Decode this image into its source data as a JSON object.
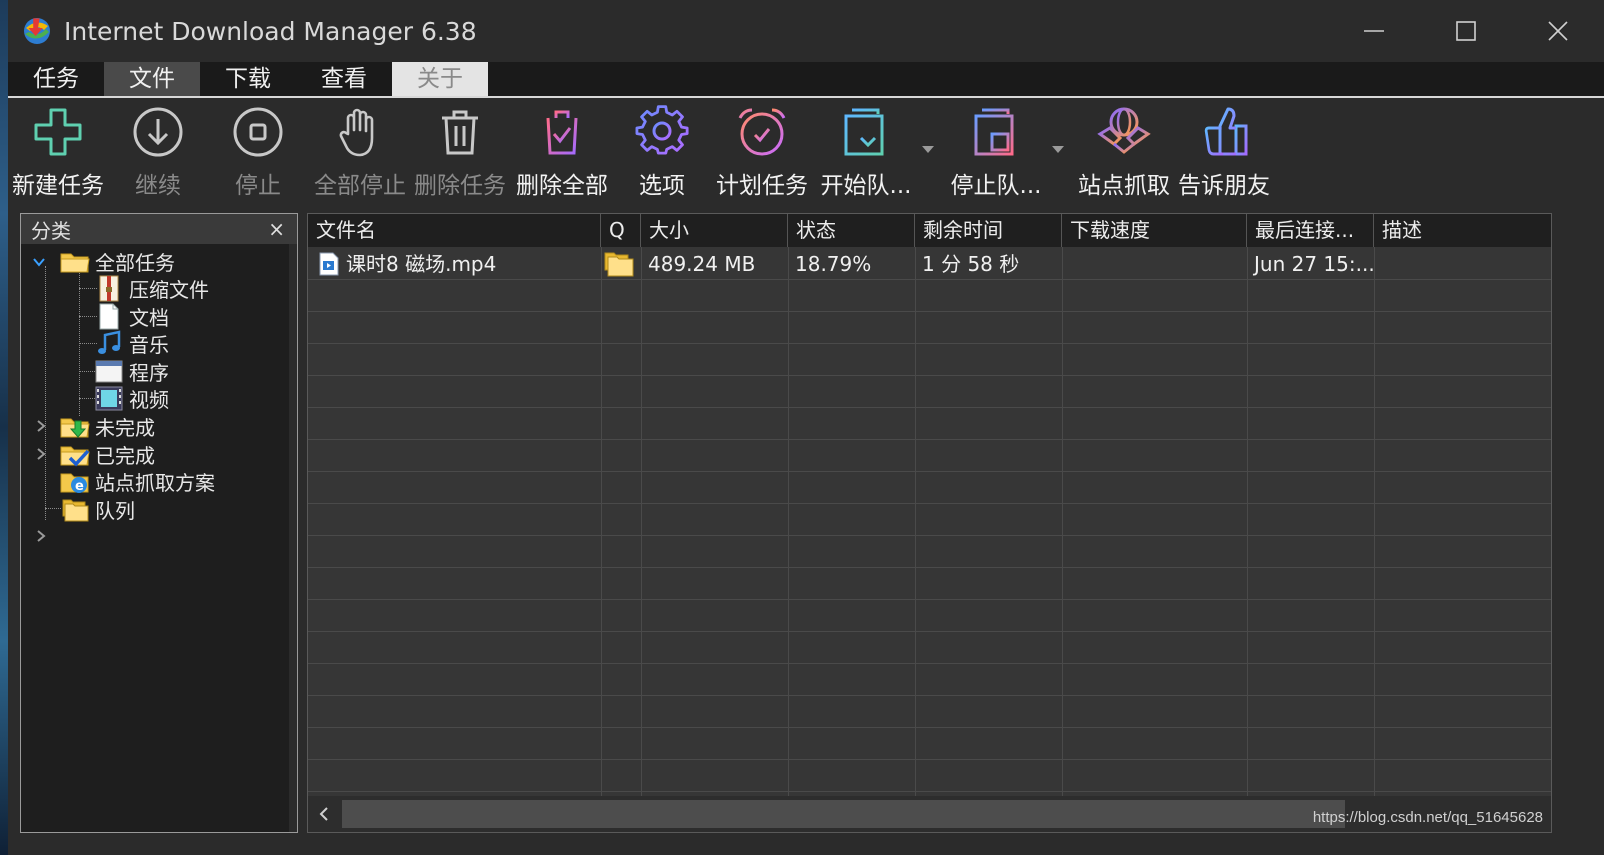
{
  "window": {
    "title": "Internet Download Manager 6.38"
  },
  "menu": [
    {
      "label": "任务",
      "state": "normal"
    },
    {
      "label": "文件",
      "state": "active"
    },
    {
      "label": "下载",
      "state": "normal"
    },
    {
      "label": "查看",
      "state": "normal"
    },
    {
      "label": "关于",
      "state": "disabled"
    }
  ],
  "toolbar": [
    {
      "label": "新建任务",
      "icon": "plus-icon",
      "enabled": true
    },
    {
      "label": "继续",
      "icon": "resume-download-icon",
      "enabled": false
    },
    {
      "label": "停止",
      "icon": "stop-icon",
      "enabled": false
    },
    {
      "label": "全部停止",
      "icon": "hand-stop-icon",
      "enabled": false
    },
    {
      "label": "删除任务",
      "icon": "trash-icon",
      "enabled": false
    },
    {
      "label": "删除全部",
      "icon": "delete-all-icon",
      "enabled": true
    },
    {
      "label": "选项",
      "icon": "gear-icon",
      "enabled": true
    },
    {
      "label": "计划任务",
      "icon": "alarm-clock-icon",
      "enabled": true
    },
    {
      "label": "开始队...",
      "icon": "start-queue-icon",
      "enabled": true
    },
    {
      "label": "停止队...",
      "icon": "stop-queue-icon",
      "enabled": true
    },
    {
      "label": "站点抓取",
      "icon": "site-grabber-icon",
      "enabled": true
    },
    {
      "label": "告诉朋友",
      "icon": "thumbs-up-icon",
      "enabled": true
    }
  ],
  "categories": {
    "header": "分类",
    "close": "×",
    "items": [
      {
        "label": "全部任务",
        "icon": "folder-icon",
        "level": 0,
        "expander": "expanded"
      },
      {
        "label": "压缩文件",
        "icon": "zip-file-icon",
        "level": 1
      },
      {
        "label": "文档",
        "icon": "document-icon",
        "level": 1
      },
      {
        "label": "音乐",
        "icon": "music-icon",
        "level": 1
      },
      {
        "label": "程序",
        "icon": "program-icon",
        "level": 1
      },
      {
        "label": "视频",
        "icon": "video-icon",
        "level": 1
      },
      {
        "label": "未完成",
        "icon": "unfinished-folder-icon",
        "level": 0,
        "expander": "collapsed"
      },
      {
        "label": "已完成",
        "icon": "finished-folder-icon",
        "level": 0,
        "expander": "collapsed"
      },
      {
        "label": "站点抓取方案",
        "icon": "ie-folder-icon",
        "level": 0
      },
      {
        "label": "队列",
        "icon": "queue-folder-icon",
        "level": 0,
        "expander": "collapsed"
      }
    ]
  },
  "columns": [
    "文件名",
    "Q",
    "大小",
    "状态",
    "剩余时间",
    "下载速度",
    "最后连接...",
    "描述"
  ],
  "downloads": [
    {
      "file_name": "课时8 磁场.mp4",
      "queue_icon": "queue-folder-icon",
      "size": "489.24  MB",
      "status": "18.79%",
      "time_left": "1 分 58 秒",
      "speed": "",
      "last_connection": "Jun 27 15:...",
      "description": ""
    }
  ],
  "watermark": "https://blog.csdn.net/qq_51645628"
}
